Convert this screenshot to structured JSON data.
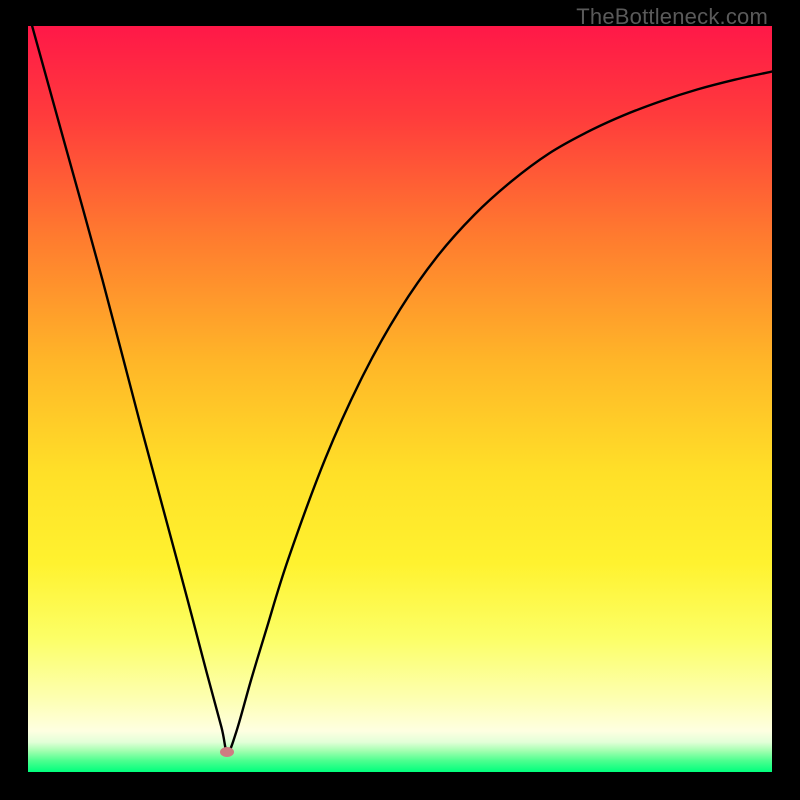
{
  "watermark": {
    "text": "TheBottleneck.com"
  },
  "colors": {
    "black": "#000000",
    "red": "#ff1848",
    "redOrange": "#ff5a33",
    "orange": "#ffa228",
    "yellowOrange": "#ffd027",
    "yellow": "#fff02a",
    "lightYellow": "#fdff67",
    "paleYellow": "#feffa6",
    "creamYellow": "#fcffd4",
    "paleGreen": "#b8ffb2",
    "green": "#00ff7d",
    "dot": "#cf7c82",
    "curve": "#000000"
  },
  "chart_data": {
    "type": "line",
    "title": "",
    "xlabel": "",
    "ylabel": "",
    "xlim": [
      0,
      100
    ],
    "ylim": [
      0,
      100
    ],
    "series": [
      {
        "name": "curve",
        "x": [
          0,
          5,
          10,
          15,
          20,
          22,
          24,
          26,
          26.8,
          28,
          30,
          32,
          35,
          40,
          45,
          50,
          55,
          60,
          65,
          70,
          75,
          80,
          85,
          90,
          95,
          100
        ],
        "values": [
          102,
          84,
          66,
          47,
          28.5,
          21,
          13.4,
          6,
          2.7,
          5.4,
          12.4,
          19,
          28.6,
          42.1,
          53.1,
          62,
          69.1,
          74.7,
          79.2,
          82.9,
          85.7,
          88,
          89.9,
          91.5,
          92.8,
          93.9
        ]
      }
    ],
    "marker": {
      "x": 26.8,
      "y": 2.7
    },
    "gradient_stops": [
      {
        "pos": 0.0,
        "color": "#ff1848"
      },
      {
        "pos": 0.12,
        "color": "#ff3b3c"
      },
      {
        "pos": 0.28,
        "color": "#ff7a2f"
      },
      {
        "pos": 0.45,
        "color": "#ffb628"
      },
      {
        "pos": 0.6,
        "color": "#ffe028"
      },
      {
        "pos": 0.72,
        "color": "#fff22f"
      },
      {
        "pos": 0.82,
        "color": "#fcff66"
      },
      {
        "pos": 0.9,
        "color": "#fdffb0"
      },
      {
        "pos": 0.945,
        "color": "#feffe1"
      },
      {
        "pos": 0.96,
        "color": "#e2ffd8"
      },
      {
        "pos": 0.972,
        "color": "#a0ffaf"
      },
      {
        "pos": 0.985,
        "color": "#4cff8f"
      },
      {
        "pos": 1.0,
        "color": "#00ff7d"
      }
    ]
  }
}
